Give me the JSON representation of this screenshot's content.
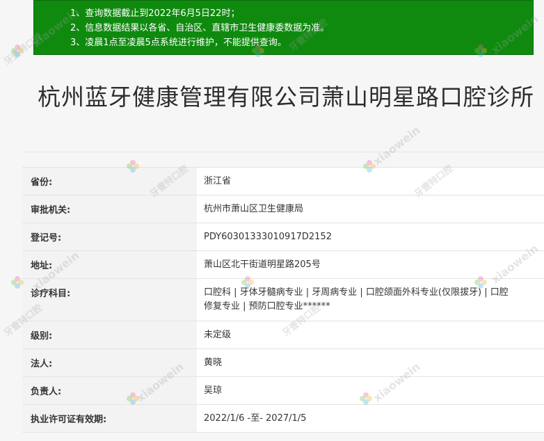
{
  "notice": {
    "lines": [
      "1、查询数据截止到2022年6月5日22时；",
      "2、信息数据结果以各省、自治区、直辖市卫生健康委数据为准。",
      "3、凌晨1点至凌晨5点系统进行维护，不能提供查询。"
    ]
  },
  "title": "杭州蓝牙健康管理有限公司萧山明星路口腔诊所",
  "info_rows": [
    {
      "label": "省份:",
      "value": "浙江省"
    },
    {
      "label": "审批机关:",
      "value": "杭州市萧山区卫生健康局"
    },
    {
      "label": "登记号:",
      "value": "PDY60301333010917D2152"
    },
    {
      "label": "地址:",
      "value": "萧山区北干街道明星路205号"
    },
    {
      "label": "诊疗科目:",
      "value": "口腔科 | 牙体牙髓病专业 | 牙周病专业 | 口腔颌面外科专业(仅限拔牙) | 口腔修复专业 | 预防口腔专业******"
    },
    {
      "label": "级别:",
      "value": "未定级"
    },
    {
      "label": "法人:",
      "value": "黄晓"
    },
    {
      "label": "负责人:",
      "value": "吴琼"
    },
    {
      "label": "执业许可证有效期:",
      "value": "2022/1/6 -至- 2027/1/5"
    }
  ],
  "watermark": {
    "latin": "xiaowein",
    "cn": "牙壹特口腔"
  },
  "colors": {
    "notice_bg": "#0f8a0f",
    "label_bg": "#f3f3f3",
    "value_bg": "#ffffff"
  }
}
